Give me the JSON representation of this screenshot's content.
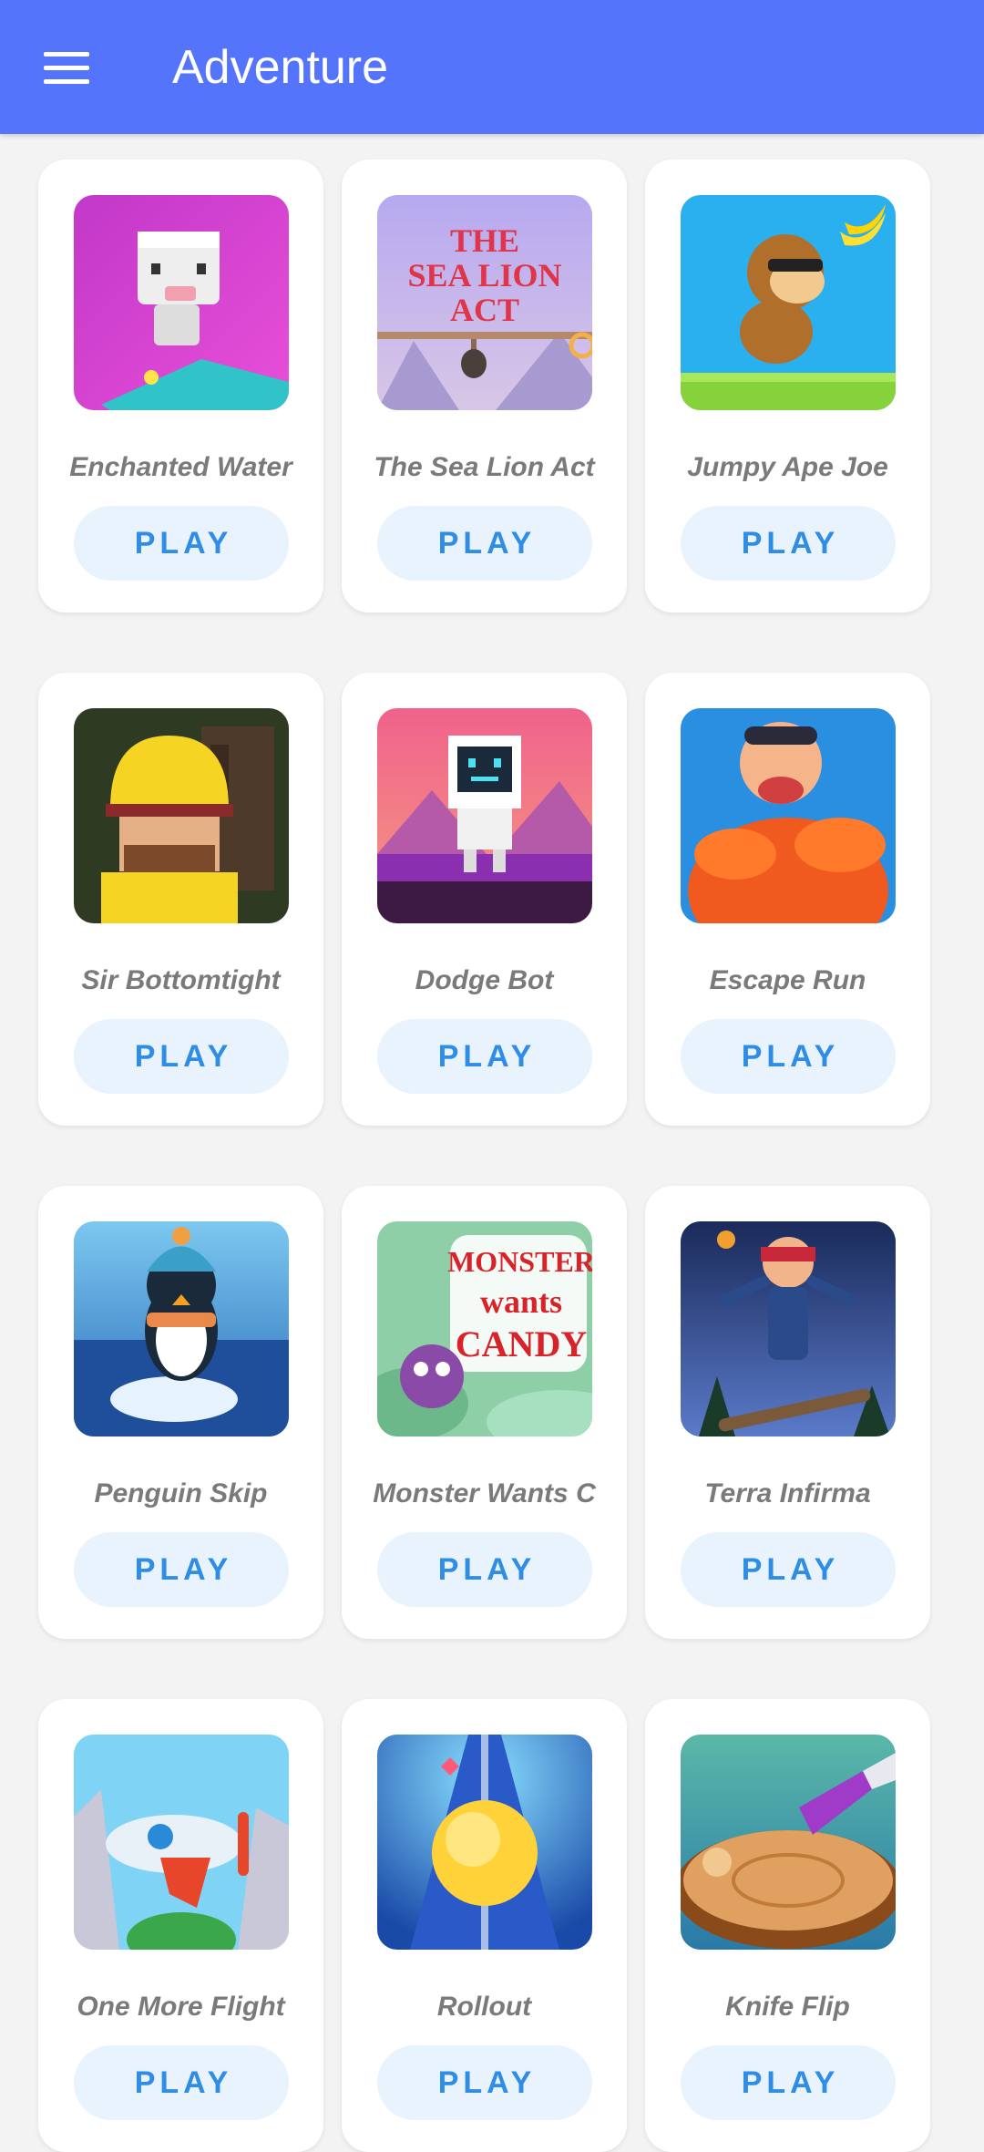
{
  "appbar": {
    "title": "Adventure",
    "menu_icon": "hamburger-menu-icon"
  },
  "colors": {
    "appbar": "#5474fb",
    "play_text": "#2f8de6",
    "play_bg": "#e8f3fd",
    "card_bg": "#ffffff",
    "page_bg": "#f3f3f4"
  },
  "games": [
    {
      "name": "Enchanted Water",
      "button": "PLAY",
      "art": "cube-cow-surfer"
    },
    {
      "name": "The Sea Lion Act",
      "button": "PLAY",
      "art": "sea-lion-act"
    },
    {
      "name": "Jumpy Ape Joe",
      "button": "PLAY",
      "art": "monkey-banana"
    },
    {
      "name": "Sir Bottomtight",
      "button": "PLAY",
      "art": "yellow-helmet-man"
    },
    {
      "name": "Dodge Bot",
      "button": "PLAY",
      "art": "white-robot"
    },
    {
      "name": "Escape Run",
      "button": "PLAY",
      "art": "orange-gorilla"
    },
    {
      "name": "Penguin Skip",
      "button": "PLAY",
      "art": "penguin-ice"
    },
    {
      "name": "Monster Wants C",
      "button": "PLAY",
      "art": "monster-candy"
    },
    {
      "name": "Terra Infirma",
      "button": "PLAY",
      "art": "ninja-skateboard"
    },
    {
      "name": "One More Flight",
      "button": "PLAY",
      "art": "airplane"
    },
    {
      "name": "Rollout",
      "button": "PLAY",
      "art": "rolling-ball"
    },
    {
      "name": "Knife Flip",
      "button": "PLAY",
      "art": "knife-log"
    }
  ],
  "thumb_texts": {
    "sea_lion": [
      "THE",
      "SEA LION",
      "ACT"
    ],
    "monster": [
      "MONSTER",
      "wants",
      "CANDY"
    ]
  }
}
